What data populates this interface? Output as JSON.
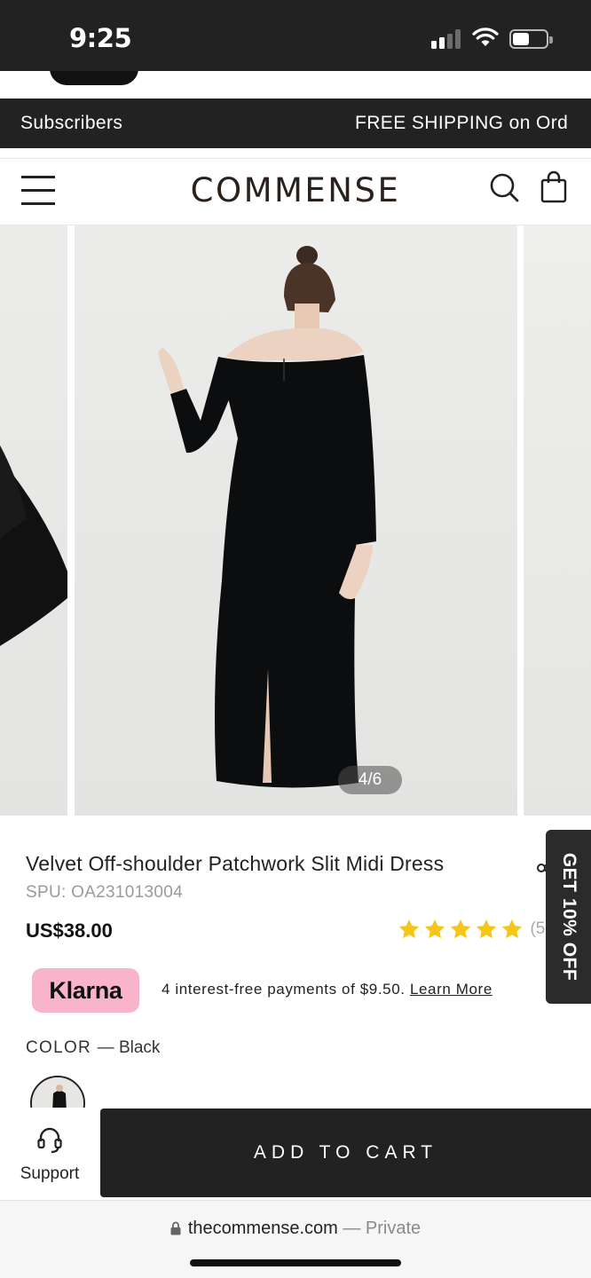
{
  "status_bar": {
    "time": "9:25",
    "battery_percent": 40
  },
  "announcement": {
    "left_text": "Subscribers",
    "right_text": "FREE SHIPPING on Ord"
  },
  "header": {
    "logo": "COMMENSE"
  },
  "gallery": {
    "counter": "4/6",
    "current": 4,
    "total": 6
  },
  "product": {
    "title": "Velvet Off-shoulder Patchwork Slit Midi Dress",
    "spu": "SPU: OA231013004",
    "price": "US$38.00",
    "rating": 5,
    "review_count": "(5)",
    "color_label": "COLOR",
    "color_value": "— Black"
  },
  "klarna": {
    "badge": "Klarna",
    "text": "4 interest-free payments of $9.50.",
    "link": "Learn More"
  },
  "promo_tab": {
    "label": "GET 10% OFF"
  },
  "bottom_bar": {
    "support_label": "Support",
    "cart_label": "ADD TO CART"
  },
  "browser": {
    "domain": "thecommense.com",
    "suffix": " — Private"
  },
  "colors": {
    "dark": "#222222",
    "klarna_pink": "#f7b4cb",
    "star": "#f5c518"
  }
}
